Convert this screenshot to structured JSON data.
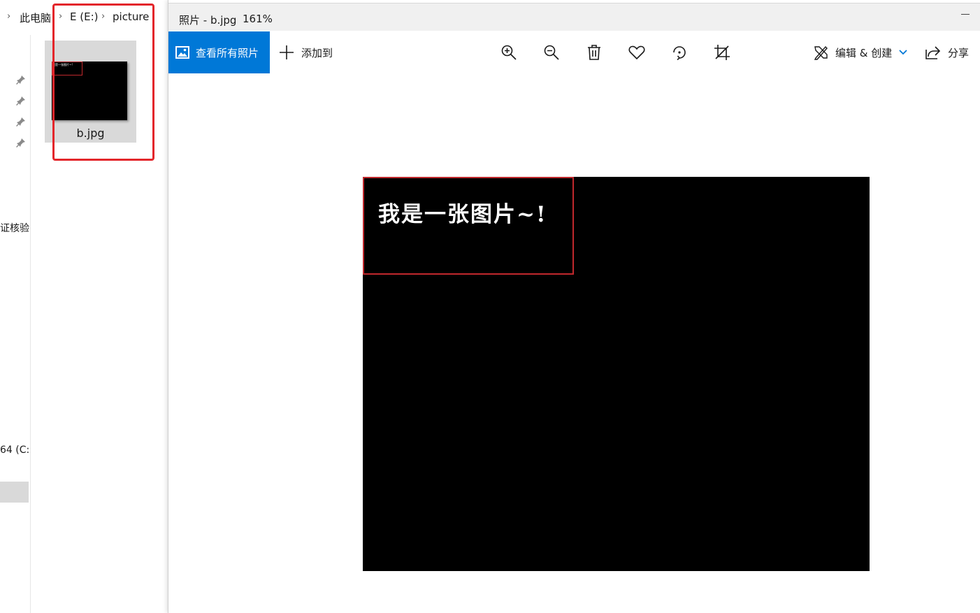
{
  "explorer": {
    "breadcrumb": [
      "此电脑",
      "E (E:)",
      "picture"
    ],
    "nav_text_1": "证核验",
    "nav_text_2": "64 (C:",
    "file": {
      "name": "b.jpg",
      "thumb_caption": "我是一张图片~!"
    },
    "highlight_color": "#e3262b"
  },
  "viewer": {
    "title": "照片 - b.jpg",
    "zoom": "161%",
    "toolbar": {
      "view_all_label": "查看所有照片",
      "add_to_label": "添加到",
      "zoom_in_icon": "zoom-in-icon",
      "zoom_out_icon": "zoom-out-icon",
      "delete_icon": "trash-icon",
      "favorite_icon": "heart-icon",
      "rotate_icon": "rotate-icon",
      "crop_icon": "crop-icon",
      "edit_create_label": "编辑 & 创建",
      "share_label": "分享"
    },
    "photo": {
      "text": "我是一张图片~!",
      "box_color": "#c0282d"
    },
    "accent_color": "#0078d7"
  }
}
